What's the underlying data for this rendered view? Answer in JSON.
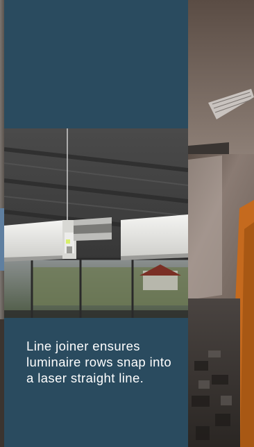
{
  "card": {
    "caption": "Line joiner ensures luminaire rows snap into a laser straight line.",
    "background_color": "#2a4b5f",
    "text_color": "#ffffff"
  },
  "images": {
    "card_photo": "pendant-luminaire-joiner-photo",
    "background_photo": "office-room-interior-photo"
  }
}
